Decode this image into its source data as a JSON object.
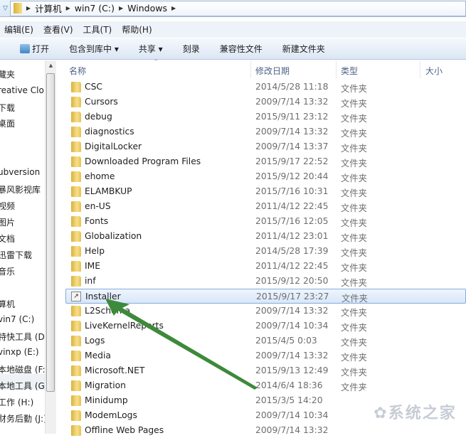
{
  "address": {
    "crumbs": [
      "计算机",
      "win7 (C:)",
      "Windows"
    ]
  },
  "menu": [
    "编辑(E)",
    "查看(V)",
    "工具(T)",
    "帮助(H)"
  ],
  "toolbar": [
    "打开",
    "包含到库中 ▾",
    "共享 ▾",
    "刻录",
    "兼容性文件",
    "新建文件夹"
  ],
  "nav": [
    [
      "藏夹",
      104
    ],
    [
      "reative Clo",
      128
    ],
    [
      "下载",
      151
    ],
    [
      "桌面",
      173
    ],
    [
      "ubversion",
      243
    ],
    [
      "暴风影视库",
      266
    ],
    [
      "视频",
      289
    ],
    [
      "图片",
      312
    ],
    [
      "文档",
      335
    ],
    [
      "迅雷下载",
      358
    ],
    [
      "音乐",
      381
    ],
    [
      "算机",
      427
    ],
    [
      "vin7 (C:)",
      450
    ],
    [
      "特快工具 (D:",
      473
    ],
    [
      "vinxp (E:)",
      496
    ],
    [
      "本地磁盘 (F:)",
      519
    ],
    [
      "本地工具 (G:",
      542
    ],
    [
      "工作 (H:)",
      565
    ],
    [
      "财务后勤 (J:)",
      588
    ]
  ],
  "columns": [
    "名称",
    "修改日期",
    "类型",
    "大小"
  ],
  "files": [
    {
      "name": "CSC",
      "date": "2014/5/28 11:18",
      "type": "文件夹"
    },
    {
      "name": "Cursors",
      "date": "2009/7/14 13:32",
      "type": "文件夹"
    },
    {
      "name": "debug",
      "date": "2015/9/11 23:12",
      "type": "文件夹"
    },
    {
      "name": "diagnostics",
      "date": "2009/7/14 13:32",
      "type": "文件夹"
    },
    {
      "name": "DigitalLocker",
      "date": "2009/7/14 13:37",
      "type": "文件夹"
    },
    {
      "name": "Downloaded Program Files",
      "date": "2015/9/17 22:52",
      "type": "文件夹"
    },
    {
      "name": "ehome",
      "date": "2015/9/12 20:44",
      "type": "文件夹"
    },
    {
      "name": "ELAMBKUP",
      "date": "2015/7/16 10:31",
      "type": "文件夹"
    },
    {
      "name": "en-US",
      "date": "2011/4/12 22:45",
      "type": "文件夹"
    },
    {
      "name": "Fonts",
      "date": "2015/7/16 12:05",
      "type": "文件夹"
    },
    {
      "name": "Globalization",
      "date": "2011/4/12 23:01",
      "type": "文件夹"
    },
    {
      "name": "Help",
      "date": "2014/5/28 17:39",
      "type": "文件夹"
    },
    {
      "name": "IME",
      "date": "2011/4/12 22:45",
      "type": "文件夹"
    },
    {
      "name": "inf",
      "date": "2015/9/12 20:50",
      "type": "文件夹"
    },
    {
      "name": "Installer",
      "date": "2015/9/17 23:27",
      "type": "文件夹",
      "selected": true
    },
    {
      "name": "L2Schema",
      "date": "2009/7/14 13:32",
      "type": "文件夹"
    },
    {
      "name": "LiveKernelReports",
      "date": "2009/7/14 10:34",
      "type": "文件夹"
    },
    {
      "name": "Logs",
      "date": "2015/4/5 0:03",
      "type": "文件夹"
    },
    {
      "name": "Media",
      "date": "2009/7/14 13:32",
      "type": "文件夹"
    },
    {
      "name": "Microsoft.NET",
      "date": "2015/9/13 12:49",
      "type": "文件夹"
    },
    {
      "name": "Migration",
      "date": "2014/6/4 18:36",
      "type": "文件夹"
    },
    {
      "name": "Minidump",
      "date": "2015/3/5 14:20",
      "type": ""
    },
    {
      "name": "ModemLogs",
      "date": "2009/7/14 10:34",
      "type": ""
    },
    {
      "name": "Offline Web Pages",
      "date": "2009/7/14 13:32",
      "type": ""
    }
  ],
  "watermark": "系统之家",
  "colors": {
    "arrow": "#3d8a3a",
    "selection": "#d8e7f9"
  }
}
